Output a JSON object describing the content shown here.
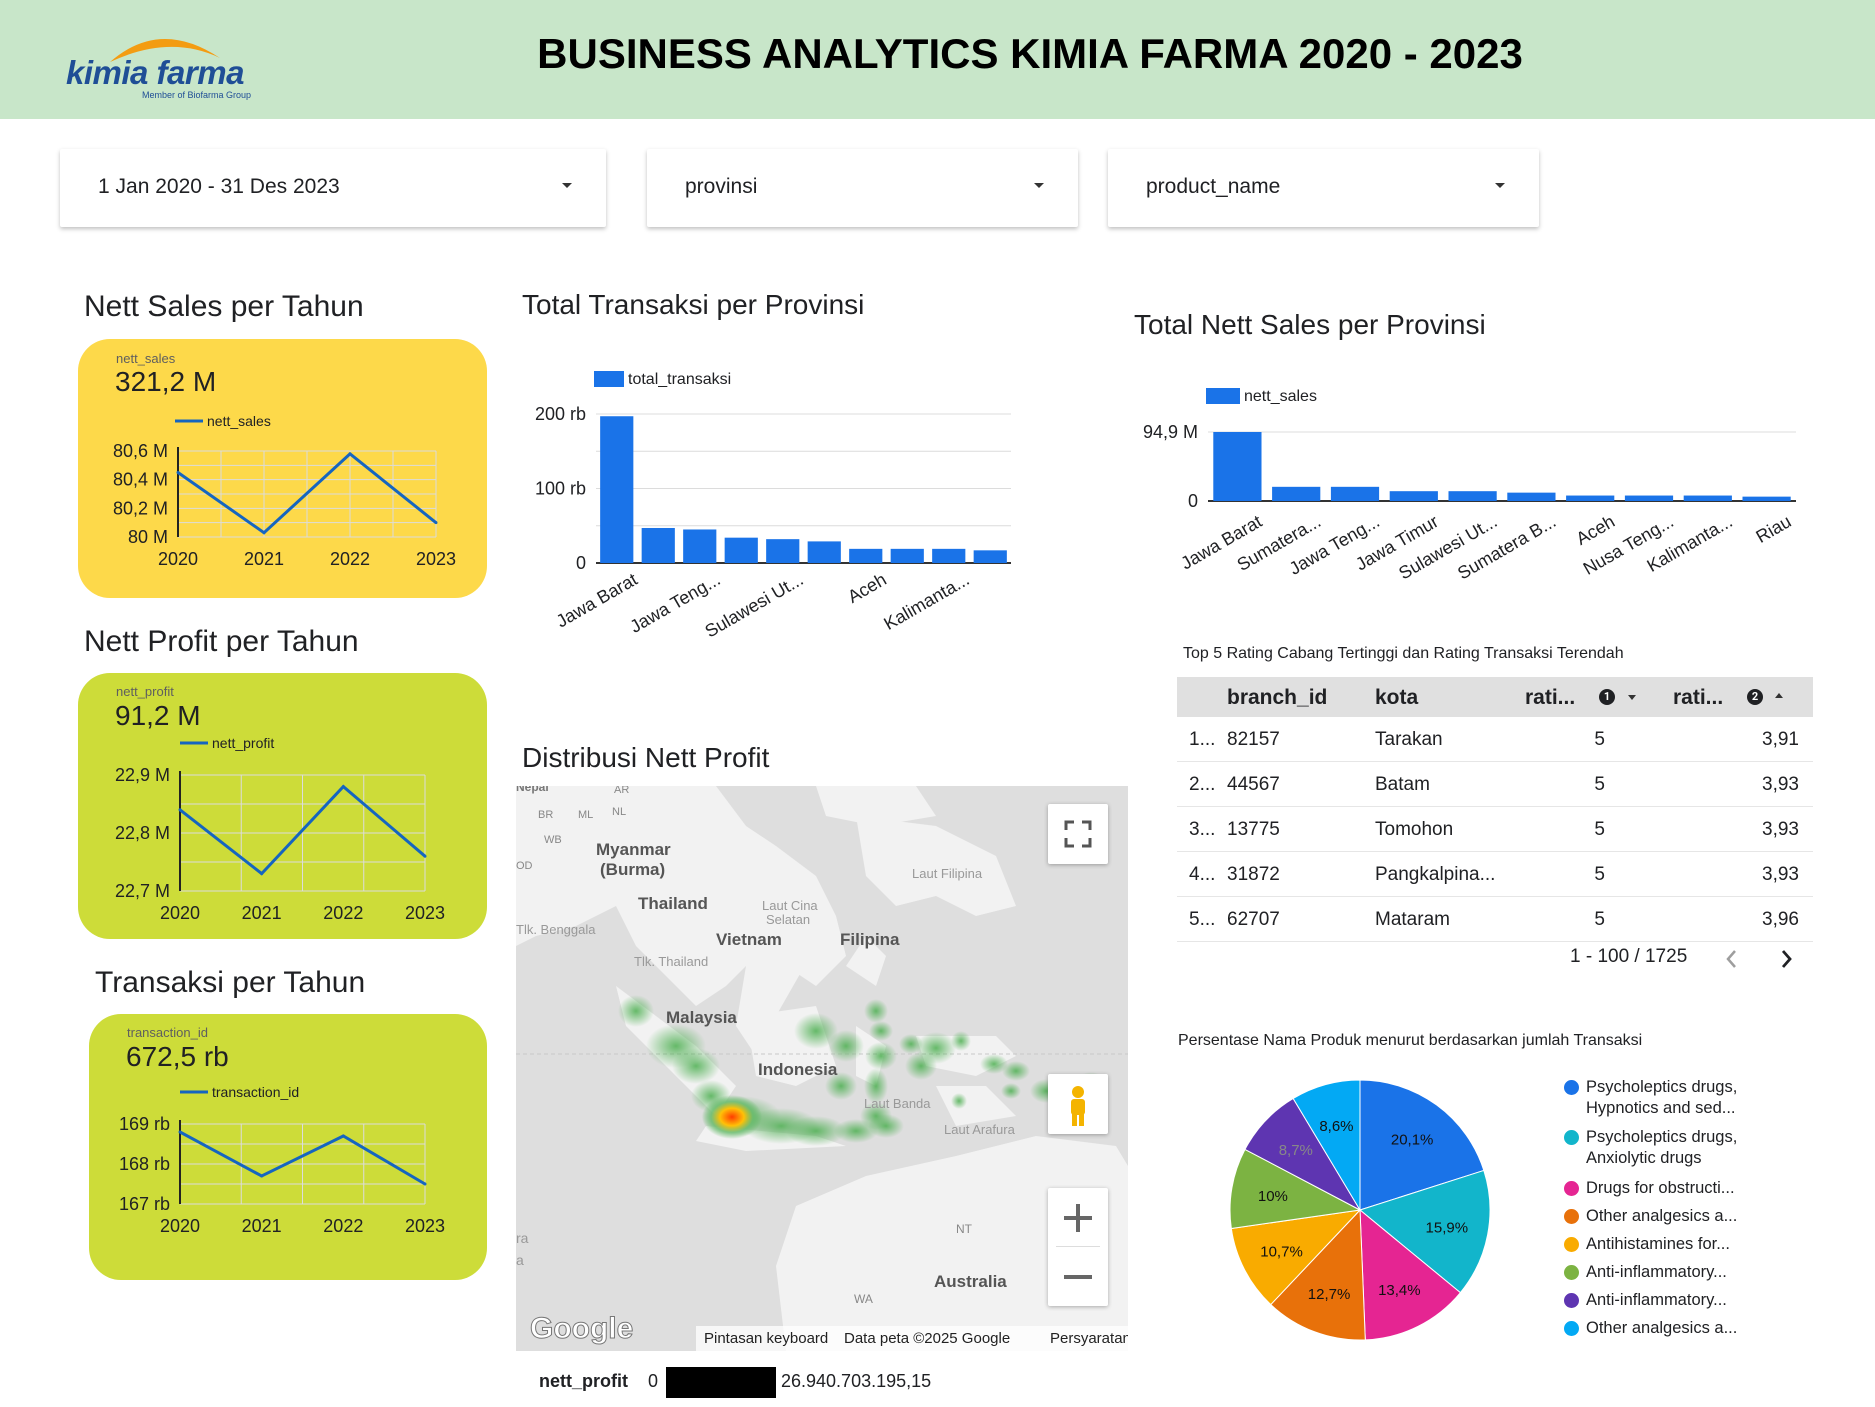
{
  "header": {
    "title": "BUSINESS ANALYTICS KIMIA FARMA 2020 - 2023",
    "logo_text": "kimia farma",
    "logo_sub": "Member of Biofarma Group"
  },
  "filters": {
    "date_range": "1 Jan 2020 - 31 Des 2023",
    "province": "provinsi",
    "product": "product_name"
  },
  "nett_sales_card": {
    "title": "Nett Sales per Tahun",
    "metric_label": "nett_sales",
    "metric_value": "321,2 M",
    "legend": "nett_sales",
    "years": [
      "2020",
      "2021",
      "2022",
      "2023"
    ],
    "y_ticks": [
      "80,6 M",
      "80,4 M",
      "80,2 M",
      "80 M"
    ]
  },
  "nett_profit_card": {
    "title": "Nett Profit per Tahun",
    "metric_label": "nett_profit",
    "metric_value": "91,2 M",
    "legend": "nett_profit",
    "years": [
      "2020",
      "2021",
      "2022",
      "2023"
    ],
    "y_ticks": [
      "22,9 M",
      "22,8 M",
      "22,7 M"
    ]
  },
  "transaksi_card": {
    "title": "Transaksi per Tahun",
    "metric_label": "transaction_id",
    "metric_value": "672,5 rb",
    "legend": "transaction_id",
    "years": [
      "2020",
      "2021",
      "2022",
      "2023"
    ],
    "y_ticks": [
      "169 rb",
      "168 rb",
      "167 rb"
    ]
  },
  "transaksi_provinsi": {
    "title": "Total Transaksi per Provinsi",
    "legend": "total_transaksi",
    "y_ticks": [
      "200 rb",
      "100 rb",
      "0"
    ],
    "x_labels": [
      "Jawa Barat",
      "Jawa Teng...",
      "Sulawesi Ut...",
      "Aceh",
      "Kalimanta..."
    ]
  },
  "nett_sales_provinsi": {
    "title": "Total Nett Sales per Provinsi",
    "legend": "nett_sales",
    "y_ticks": [
      "94,9 M",
      "0"
    ],
    "x_labels": [
      "Jawa Barat",
      "Sumatera...",
      "Jawa Teng...",
      "Jawa Timur",
      "Sulawesi Ut...",
      "Sumatera B...",
      "Aceh",
      "Nusa Teng...",
      "Kalimanta...",
      "Riau"
    ]
  },
  "map": {
    "title": "Distribusi Nett Profit",
    "labels": {
      "nepal": "Nepal",
      "ar": "AR",
      "br": "BR",
      "ml": "ML",
      "nl": "NL",
      "wb": "WB",
      "od": "OD",
      "myanmar": "Myanmar",
      "burma": "(Burma)",
      "thailand": "Thailand",
      "laut_cina": "Laut Cina",
      "selatan": "Selatan",
      "laut_filipina": "Laut Filipina",
      "tlk_benggala": "Tlk. Benggala",
      "vietnam": "Vietnam",
      "filipina": "Filipina",
      "tlk_thailand": "Tlk. Thailand",
      "malaysia": "Malaysia",
      "indonesia": "Indonesia",
      "laut_banda": "Laut Banda",
      "laut_arafura": "Laut Arafura",
      "nt": "NT",
      "wa": "WA",
      "australia": "Australia",
      "ra": "ra",
      "a": "a"
    },
    "google": "Google",
    "shortcut": "Pintasan keyboard",
    "map_data": "Data peta ©2025 Google",
    "terms": "Persyaratan",
    "legend_label": "nett_profit",
    "legend_min": "0",
    "legend_max": "26.940.703.195,15"
  },
  "rating_table": {
    "title": "Top 5 Rating Cabang Tertinggi dan Rating Transaksi Terendah",
    "headers": [
      "branch_id",
      "kota",
      "rati...",
      "rati..."
    ],
    "sort_badges": [
      "1",
      "2"
    ],
    "rows": [
      {
        "idx": "1...",
        "branch_id": "82157",
        "kota": "Tarakan",
        "r1": "5",
        "r2": "3,91"
      },
      {
        "idx": "2...",
        "branch_id": "44567",
        "kota": "Batam",
        "r1": "5",
        "r2": "3,93"
      },
      {
        "idx": "3...",
        "branch_id": "13775",
        "kota": "Tomohon",
        "r1": "5",
        "r2": "3,93"
      },
      {
        "idx": "4...",
        "branch_id": "31872",
        "kota": "Pangkalpina...",
        "r1": "5",
        "r2": "3,93"
      },
      {
        "idx": "5...",
        "branch_id": "62707",
        "kota": "Mataram",
        "r1": "5",
        "r2": "3,96"
      }
    ],
    "pagination": "1 - 100 / 1725"
  },
  "pie": {
    "title": "Persentase Nama Produk menurut berdasarkan jumlah Transaksi",
    "legend": [
      {
        "l1": "Psycholeptics drugs,",
        "l2": "Hypnotics and sed..."
      },
      {
        "l1": "Psycholeptics drugs,",
        "l2": "Anxiolytic drugs"
      },
      {
        "l1": "Drugs for obstructi...",
        "l2": ""
      },
      {
        "l1": "Other analgesics a...",
        "l2": ""
      },
      {
        "l1": "Antihistamines for...",
        "l2": ""
      },
      {
        "l1": "Anti-inflammatory...",
        "l2": ""
      },
      {
        "l1": "Anti-inflammatory...",
        "l2": ""
      },
      {
        "l1": "Other analgesics a...",
        "l2": ""
      }
    ],
    "slice_labels": [
      "20,1%",
      "15,9%",
      "13,4%",
      "12,7%",
      "10,7%",
      "10%",
      "8,7%",
      "8,6%"
    ]
  },
  "chart_data": [
    {
      "type": "line",
      "title": "Nett Sales per Tahun",
      "x": [
        "2020",
        "2021",
        "2022",
        "2023"
      ],
      "series": [
        {
          "name": "nett_sales",
          "values": [
            80.45,
            80.03,
            80.58,
            80.1
          ]
        }
      ],
      "ylabel": "",
      "ylim": [
        80.0,
        80.6
      ],
      "unit": "M",
      "colors": [
        "#1565c0"
      ]
    },
    {
      "type": "line",
      "title": "Nett Profit per Tahun",
      "x": [
        "2020",
        "2021",
        "2022",
        "2023"
      ],
      "series": [
        {
          "name": "nett_profit",
          "values": [
            22.84,
            22.73,
            22.88,
            22.76
          ]
        }
      ],
      "ylim": [
        22.7,
        22.9
      ],
      "unit": "M",
      "colors": [
        "#1565c0"
      ]
    },
    {
      "type": "line",
      "title": "Transaksi per Tahun",
      "x": [
        "2020",
        "2021",
        "2022",
        "2023"
      ],
      "series": [
        {
          "name": "transaction_id",
          "values": [
            168.8,
            167.7,
            168.7,
            167.5
          ]
        }
      ],
      "ylim": [
        167,
        169
      ],
      "unit": "rb",
      "colors": [
        "#1565c0"
      ]
    },
    {
      "type": "bar",
      "title": "Total Transaksi per Provinsi",
      "categories": [
        "Jawa Barat",
        "Jawa Tengah",
        "",
        "Sulawesi Utara",
        "",
        "Aceh",
        "",
        "Kalimantan",
        "",
        ""
      ],
      "series": [
        {
          "name": "total_transaksi",
          "values": [
            197,
            47,
            45,
            34,
            32,
            29,
            19,
            19,
            19,
            17
          ]
        }
      ],
      "ylim": [
        0,
        200
      ],
      "unit": "rb",
      "colors": [
        "#1a73e8"
      ]
    },
    {
      "type": "bar",
      "title": "Total Nett Sales per Provinsi",
      "categories": [
        "Jawa Barat",
        "Sumatera...",
        "Jawa Teng...",
        "Jawa Timur",
        "Sulawesi Ut...",
        "Sumatera B...",
        "Aceh",
        "Nusa Teng...",
        "Kalimanta...",
        "Riau"
      ],
      "series": [
        {
          "name": "nett_sales",
          "values": [
            94.9,
            19.5,
            19.5,
            13.5,
            13.5,
            11.5,
            7.5,
            7.5,
            7.5,
            6
          ]
        }
      ],
      "ylim": [
        0,
        94.9
      ],
      "unit": "M",
      "colors": [
        "#1a73e8"
      ]
    },
    {
      "type": "pie",
      "title": "Persentase Nama Produk menurut berdasarkan jumlah Transaksi",
      "categories": [
        "Psycholeptics drugs, Hypnotics and sed...",
        "Psycholeptics drugs, Anxiolytic drugs",
        "Drugs for obstructi...",
        "Other analgesics a...",
        "Antihistamines for...",
        "Anti-inflammatory...",
        "Anti-inflammatory...",
        "Other analgesics a..."
      ],
      "values": [
        20.1,
        15.9,
        13.4,
        12.7,
        10.7,
        10,
        8.7,
        8.6
      ],
      "colors": [
        "#1a73e8",
        "#12b5cb",
        "#e52592",
        "#e8710a",
        "#f9ab00",
        "#7cb342",
        "#5e35b1",
        "#03a9f4"
      ]
    }
  ]
}
